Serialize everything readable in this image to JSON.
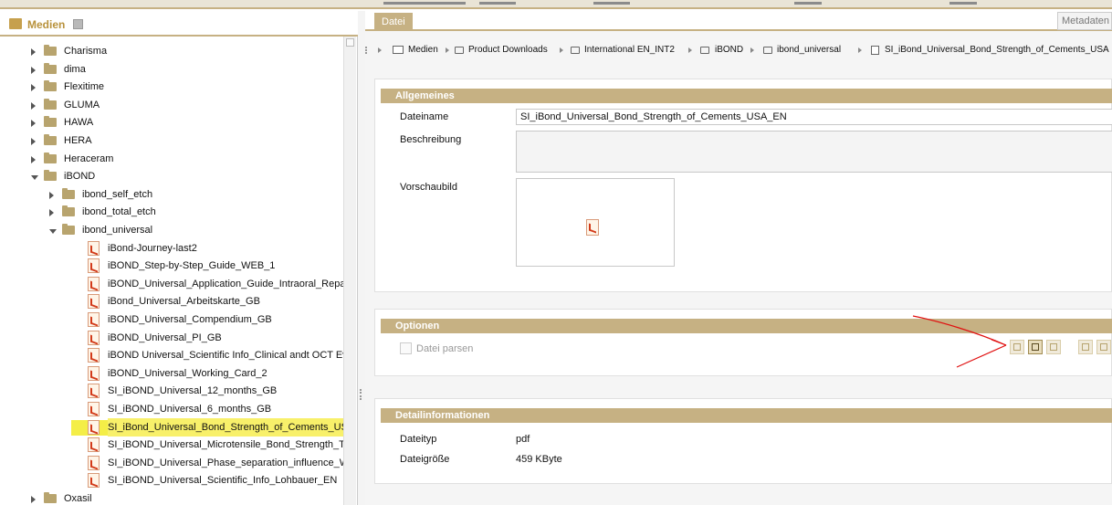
{
  "left": {
    "title": "Medien",
    "tree": [
      {
        "label": "Charisma",
        "type": "folder",
        "state": "closed",
        "level": 0
      },
      {
        "label": "dima",
        "type": "folder",
        "state": "closed",
        "level": 0
      },
      {
        "label": "Flexitime",
        "type": "folder",
        "state": "closed",
        "level": 0
      },
      {
        "label": "GLUMA",
        "type": "folder",
        "state": "closed",
        "level": 0
      },
      {
        "label": "HAWA",
        "type": "folder",
        "state": "closed",
        "level": 0
      },
      {
        "label": "HERA",
        "type": "folder",
        "state": "closed",
        "level": 0
      },
      {
        "label": "Heraceram",
        "type": "folder",
        "state": "closed",
        "level": 0
      },
      {
        "label": "iBOND",
        "type": "folder",
        "state": "open",
        "level": 0
      },
      {
        "label": "ibond_self_etch",
        "type": "folder",
        "state": "closed",
        "level": 1
      },
      {
        "label": "ibond_total_etch",
        "type": "folder",
        "state": "closed",
        "level": 1
      },
      {
        "label": "ibond_universal",
        "type": "folder",
        "state": "open",
        "level": 1
      },
      {
        "label": "iBond-Journey-last2",
        "type": "file",
        "level": 2
      },
      {
        "label": "iBOND_Step-by-Step_Guide_WEB_1",
        "type": "file",
        "level": 2
      },
      {
        "label": "iBOND_Universal_Application_Guide_Intraoral_Repair_(",
        "type": "file",
        "level": 2
      },
      {
        "label": "iBond_Universal_Arbeitskarte_GB",
        "type": "file",
        "level": 2
      },
      {
        "label": "iBOND_Universal_Compendium_GB",
        "type": "file",
        "level": 2
      },
      {
        "label": "iBOND_Universal_PI_GB",
        "type": "file",
        "level": 2
      },
      {
        "label": "iBOND Universal_Scientific Info_Clinical andt OCT Evalu",
        "type": "file",
        "level": 2
      },
      {
        "label": "iBOND_Universal_Working_Card_2",
        "type": "file",
        "level": 2
      },
      {
        "label": "SI_iBOND_Universal_12_months_GB",
        "type": "file",
        "level": 2
      },
      {
        "label": "SI_iBOND_Universal_6_months_GB",
        "type": "file",
        "level": 2
      },
      {
        "label": "SI_iBond_Universal_Bond_Strength_of_Cements_USA_",
        "type": "file",
        "level": 2,
        "selected": true
      },
      {
        "label": "SI_iBOND_Universal_Microtensile_Bond_Strength_Turkey",
        "type": "file",
        "level": 2
      },
      {
        "label": "SI_iBOND_Universal_Phase_separation_influence_Web",
        "type": "file",
        "level": 2
      },
      {
        "label": "SI_iBOND_Universal_Scientific_Info_Lohbauer_EN",
        "type": "file",
        "level": 2
      },
      {
        "label": "Oxasil",
        "type": "folder",
        "state": "closed",
        "level": 0
      }
    ]
  },
  "tabs": {
    "datei": "Datei",
    "metadaten": "Metadaten"
  },
  "breadcrumb": [
    "Medien",
    "Product Downloads",
    "International EN_INT2",
    "iBOND",
    "ibond_universal",
    "SI_iBond_Universal_Bond_Strength_of_Cements_USA"
  ],
  "allgemeines": {
    "title": "Allgemeines",
    "dateiname_label": "Dateiname",
    "dateiname_value": "SI_iBond_Universal_Bond_Strength_of_Cements_USA_EN",
    "beschreibung_label": "Beschreibung",
    "vorschaubild_label": "Vorschaubild"
  },
  "optionen": {
    "title": "Optionen",
    "datei_parsen_label": "Datei parsen",
    "datei_parsen_checked": false,
    "toolbar_icons": [
      "open-icon",
      "folder-open-icon",
      "replace-icon",
      "download-icon",
      "grid-icon"
    ]
  },
  "detail": {
    "title": "Detailinformationen",
    "dateityp_label": "Dateityp",
    "dateityp_value": "pdf",
    "groesse_label": "Dateigröße",
    "groesse_value": "459 KByte"
  },
  "colors": {
    "accent": "#c6b183",
    "highlight": "#f4ee47",
    "annotation": "#e01010"
  }
}
